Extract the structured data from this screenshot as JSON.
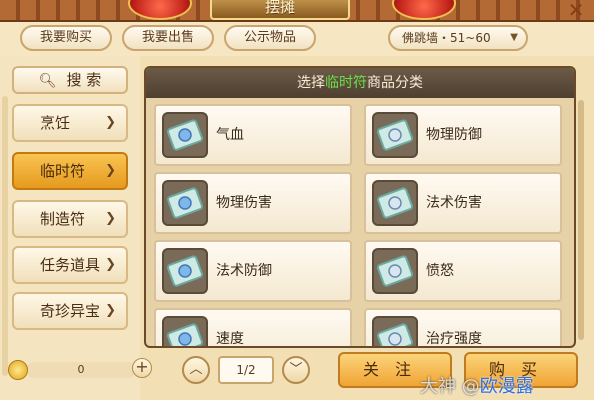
{
  "window": {
    "title": "摆摊",
    "close_icon": "close-icon"
  },
  "tabs": [
    {
      "label": "我要购买"
    },
    {
      "label": "我要出售"
    },
    {
      "label": "公示物品"
    }
  ],
  "server": {
    "value": "佛跳墙・51~60"
  },
  "sidebar": {
    "search_label": "搜 索",
    "items": [
      {
        "label": "烹饪"
      },
      {
        "label": "临时符"
      },
      {
        "label": "制造符"
      },
      {
        "label": "任务道具"
      },
      {
        "label": "奇珍异宝"
      }
    ],
    "active": "临时符"
  },
  "panel": {
    "header_prefix": "选择",
    "header_highlight": "临时符",
    "header_suffix": "商品分类",
    "categories": [
      {
        "label": "气血"
      },
      {
        "label": "物理防御"
      },
      {
        "label": "物理伤害"
      },
      {
        "label": "法术伤害"
      },
      {
        "label": "法术防御"
      },
      {
        "label": "愤怒"
      },
      {
        "label": "速度"
      },
      {
        "label": "治疗强度"
      }
    ]
  },
  "bottom": {
    "coin_amount": "0",
    "page": "1/2",
    "follow_label": "关注",
    "buy_label": "购买"
  },
  "watermark": {
    "text_prefix": "大神 @",
    "text_suffix": "欧漫露"
  },
  "colors": {
    "accent_orange": "#f0a434",
    "header_highlight_green": "#6ce04a",
    "panel_header_bg": "#4e3f30"
  }
}
